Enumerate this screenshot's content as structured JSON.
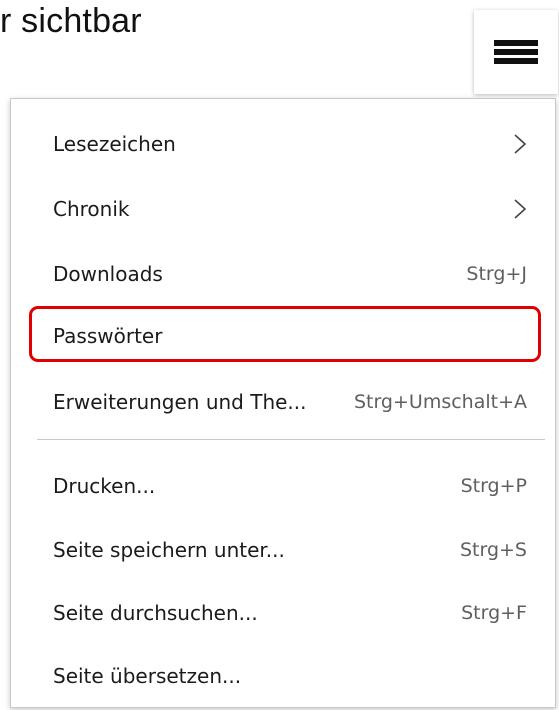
{
  "header": {
    "partial_text": "r sichtbar"
  },
  "colors": {
    "highlight": "#e00000",
    "text": "#1b1b1b",
    "shortcut": "#5f5f5f",
    "border": "#c8c8c8"
  },
  "menu": {
    "button_icon": "hamburger-icon",
    "items": [
      {
        "label": "Lesezeichen",
        "shortcut": "",
        "submenu": true
      },
      {
        "label": "Chronik",
        "shortcut": "",
        "submenu": true
      },
      {
        "label": "Downloads",
        "shortcut": "Strg+J",
        "submenu": false
      },
      {
        "label": "Passwörter",
        "shortcut": "",
        "submenu": false,
        "highlighted": true
      },
      {
        "label": "Erweiterungen und The...",
        "shortcut": "Strg+Umschalt+A",
        "submenu": false
      },
      {
        "label": "Drucken...",
        "shortcut": "Strg+P",
        "submenu": false
      },
      {
        "label": "Seite speichern unter...",
        "shortcut": "Strg+S",
        "submenu": false
      },
      {
        "label": "Seite durchsuchen...",
        "shortcut": "Strg+F",
        "submenu": false
      },
      {
        "label": "Seite übersetzen...",
        "shortcut": "",
        "submenu": false
      }
    ]
  }
}
